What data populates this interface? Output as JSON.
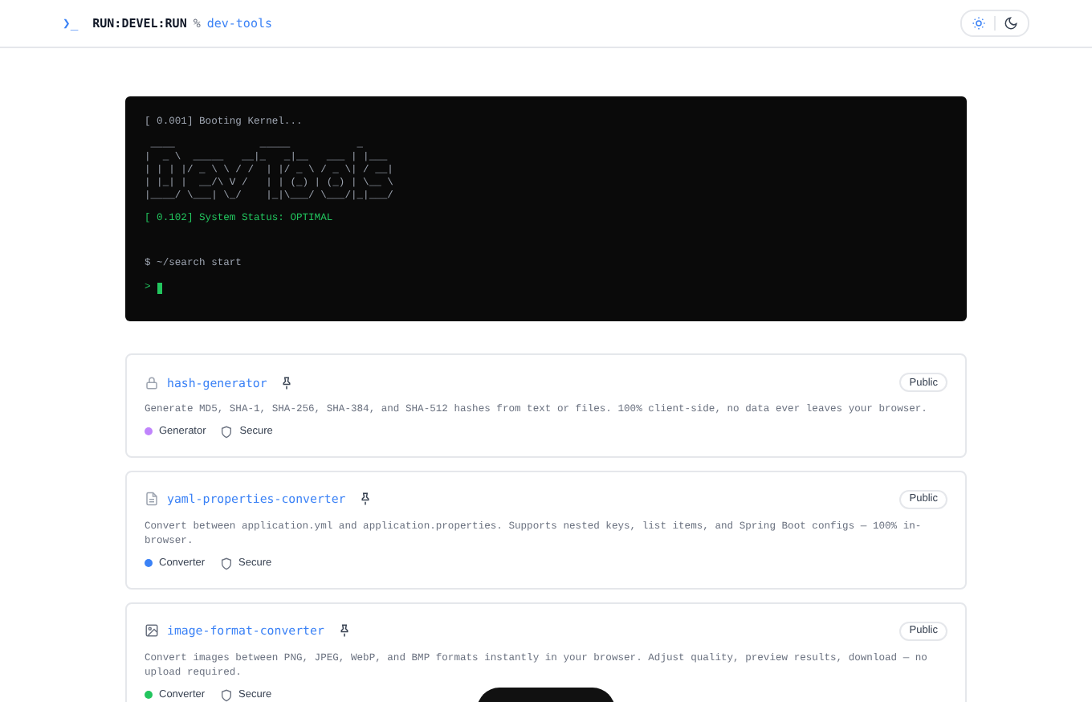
{
  "header": {
    "prompt_symbol": "❯_",
    "brand": "RUN:DEVEL:RUN",
    "separator": "%",
    "path": "dev-tools",
    "theme_toggle": [
      {
        "kind": "sun",
        "selected": true
      },
      {
        "kind": "moon",
        "selected": false
      }
    ]
  },
  "terminal": {
    "lines": [
      {
        "kind": "log",
        "text": "[ 0.001] Booting Kernel..."
      },
      {
        "kind": "art",
        "text": " ____              _____           _     \n|  _ \\  _____   __|_   _|__   ___ | |___ \n| | | |/ _ \\ \\ / /  | |/ _ \\ / _ \\| / __|\n| |_| |  __/\\ V /   | | (_) | (_) | \\__ \\\n|____/ \\___| \\_/    |_|\\___/ \\___/|_|___/"
      },
      {
        "kind": "ok",
        "text": "[ 0.102] System Status: OPTIMAL"
      },
      {
        "kind": "command",
        "text": "$ ~/search start"
      },
      {
        "kind": "prompt",
        "text": ">"
      }
    ]
  },
  "tools": [
    {
      "kind": "lock",
      "name": "hash-generator",
      "badge": "Public",
      "description": "Generate MD5, SHA-1, SHA-256, SHA-384, and SHA-512 hashes from text or files. 100% client-side, no data ever leaves your browser.",
      "category": "Generator",
      "color": "#c084fc",
      "security": "Secure"
    },
    {
      "kind": "file",
      "name": "yaml-properties-converter",
      "badge": "Public",
      "description": "Convert between application.yml and application.properties. Supports nested keys, list items, and Spring Boot configs — 100% in-browser.",
      "category": "Converter",
      "color": "#3b82f6",
      "security": "Secure"
    },
    {
      "kind": "image",
      "name": "image-format-converter",
      "badge": "Public",
      "description": "Convert images between PNG, JPEG, WebP, and BMP formats instantly in your browser. Adjust quality, preview results, download — no upload required.",
      "category": "Converter",
      "color": "#22c55e",
      "security": "Secure"
    }
  ]
}
